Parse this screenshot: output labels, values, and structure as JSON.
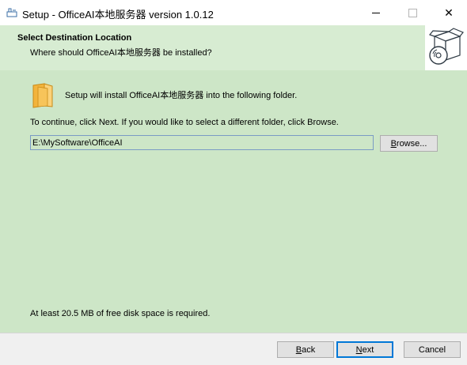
{
  "window": {
    "title": "Setup - OfficeAI本地服务器 version 1.0.12",
    "close_glyph": "✕"
  },
  "header": {
    "title": "Select Destination Location",
    "subtitle": "Where should OfficeAI本地服务器 be installed?"
  },
  "main": {
    "install_text": "Setup will install OfficeAI本地服务器 into the following folder.",
    "continue_text": "To continue, click Next. If you would like to select a different folder, click Browse.",
    "path_value": "E:\\MySoftware\\OfficeAI",
    "browse_label_hotkey": "B",
    "browse_label_rest": "rowse...",
    "disk_space_text": "At least 20.5 MB of free disk space is required."
  },
  "footer": {
    "back_hotkey": "B",
    "back_rest": "ack",
    "next_hotkey": "N",
    "next_rest": "ext",
    "cancel_label": "Cancel"
  },
  "colors": {
    "header_bg": "#d7ecd2",
    "main_bg": "#cde6c7",
    "input_border": "#7a9bc4",
    "default_button_border": "#0078d7"
  },
  "icons": {
    "app": "setup-app-icon",
    "folder": "folder-icon",
    "wizard": "software-box-cd-icon"
  }
}
